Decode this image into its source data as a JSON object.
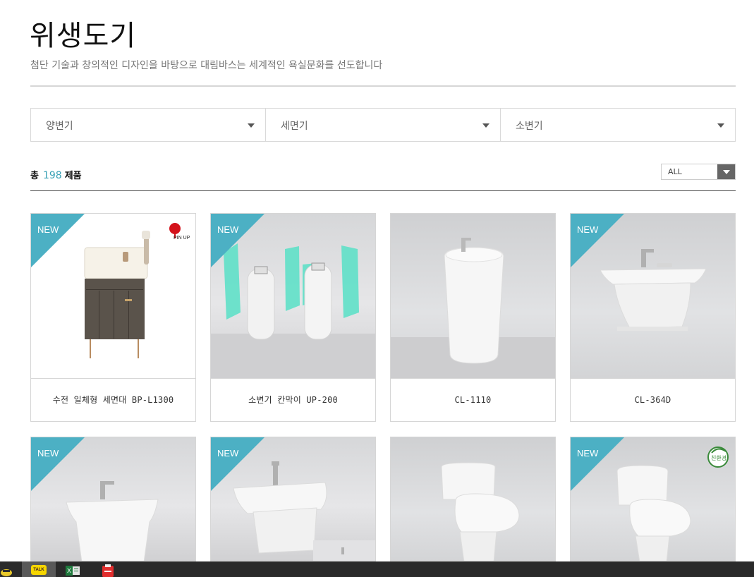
{
  "header": {
    "title": "위생도기",
    "subtitle": "첨단 기술과 창의적인 디자인을 바탕으로 대림바스는 세계적인 욕실문화를 선도합니다"
  },
  "filters": [
    {
      "label": "양변기"
    },
    {
      "label": "세면기"
    },
    {
      "label": "소변기"
    }
  ],
  "summary": {
    "prefix": "총",
    "count": "198",
    "suffix": "제품",
    "sort_value": "ALL"
  },
  "badges": {
    "new": "NEW",
    "pinup": "PIN UP",
    "eco": "친환경"
  },
  "products": [
    {
      "name": "수전 일체형 세면대 BP-L1300",
      "is_new": true
    },
    {
      "name": "소변기 칸막이 UP-200",
      "is_new": true
    },
    {
      "name": "CL-1110",
      "is_new": false
    },
    {
      "name": "CL-364D",
      "is_new": true
    },
    {
      "name": "",
      "is_new": true
    },
    {
      "name": "",
      "is_new": true
    },
    {
      "name": "",
      "is_new": false
    },
    {
      "name": "",
      "is_new": true
    }
  ],
  "taskbar": {
    "icons": [
      "explorer-icon",
      "kakaotalk-icon",
      "excel-icon",
      "pdf-icon"
    ],
    "kakao_label": "TALK"
  },
  "colors": {
    "accent": "#4cb0c4",
    "count_color": "#3aa1b6",
    "urinal_partition": "#5fe0c8",
    "cabinet": "#5a534b"
  }
}
